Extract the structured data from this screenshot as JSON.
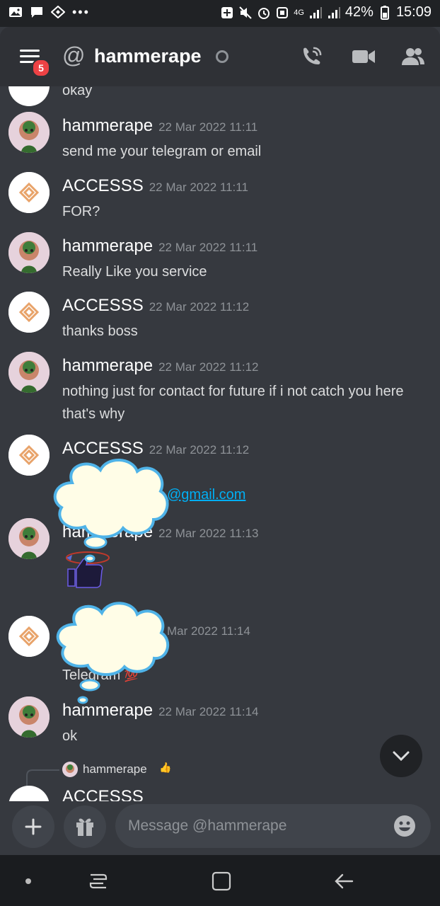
{
  "status_bar": {
    "network": "4G",
    "battery": "42%",
    "time": "15:09"
  },
  "header": {
    "unread_badge": "5",
    "at_symbol": "@",
    "title": "hammerape"
  },
  "messages": [
    {
      "text": "okay"
    },
    {
      "user": "hammerape",
      "time": "22 Mar 2022 11:11",
      "text": "send me your telegram or email"
    },
    {
      "user": "ACCESSS",
      "time": "22 Mar 2022 11:11",
      "text": "FOR?"
    },
    {
      "user": "hammerape",
      "time": "22 Mar 2022 11:11",
      "text": "Really Like you service"
    },
    {
      "user": "ACCESSS",
      "time": "22 Mar 2022 11:12",
      "text": "thanks boss"
    },
    {
      "user": "hammerape",
      "time": "22 Mar 2022 11:12",
      "text": "nothing just for contact for future if i not catch you here that's why"
    },
    {
      "user": "ACCESSS",
      "time": "22 Mar 2022 11:12",
      "link": "@gmail.com"
    },
    {
      "user": "hammerape",
      "time": "22 Mar 2022 11:13"
    },
    {
      "time": "Mar 2022 11:14",
      "text": "Telegram"
    },
    {
      "user": "hammerape",
      "time": "22 Mar 2022 11:14",
      "text": "ok"
    }
  ],
  "reply_preview": {
    "user": "hammerape",
    "next_user_partial": "ACCESSS"
  },
  "composer": {
    "placeholder": "Message @hammerape"
  },
  "colors": {
    "background": "#36393f",
    "header": "#2f3136",
    "badge": "#ed4245",
    "link": "#00aff4"
  }
}
